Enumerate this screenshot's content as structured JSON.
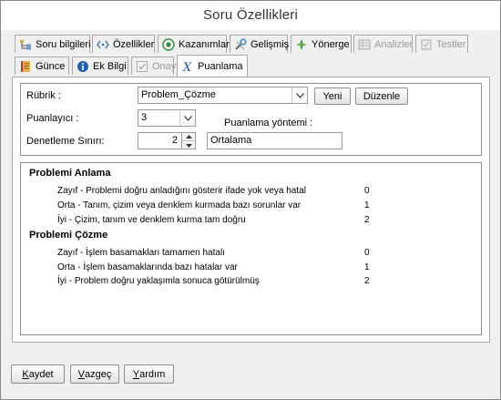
{
  "window": {
    "title": "Soru Özellikleri"
  },
  "tabs": [
    {
      "label": "Soru bilgileri",
      "icon": "info-tree-icon",
      "state": "normal"
    },
    {
      "label": "Özellikler",
      "icon": "code-brackets-icon",
      "state": "normal"
    },
    {
      "label": "Kazanımlar",
      "icon": "target-icon",
      "state": "normal"
    },
    {
      "label": "Gelişmiş",
      "icon": "tools-icon",
      "state": "normal"
    },
    {
      "label": "Yönerge",
      "icon": "compass-icon",
      "state": "normal"
    },
    {
      "label": "Analizler",
      "icon": "table-icon",
      "state": "disabled"
    },
    {
      "label": "Testler",
      "icon": "test-icon",
      "state": "disabled"
    },
    {
      "label": "Günce",
      "icon": "notebook-icon",
      "state": "normal"
    },
    {
      "label": "Ek Bilgi",
      "icon": "info-circle-icon",
      "state": "normal"
    },
    {
      "label": "Onay",
      "icon": "checkbox-icon",
      "state": "disabled"
    },
    {
      "label": "Puanlama",
      "icon": "formula-icon",
      "state": "active"
    }
  ],
  "form": {
    "rubric_label": "Rübrik :",
    "rubric_value": "Problem_Çözme",
    "new_button": "Yeni",
    "edit_button": "Düzenle",
    "scorer_label": "Puanlayıcı :",
    "scorer_value": "3",
    "method_label": "Puanlama yöntemi :",
    "limit_label": "Denetleme Sınırı:",
    "limit_value": "2",
    "method_value": "Ortalama"
  },
  "rubric": [
    {
      "title": "Problemi Anlama",
      "rows": [
        {
          "desc": "Zayıf - Problemi doğru anladığını gösterir ifade yok veya hatal",
          "points": "0"
        },
        {
          "desc": "Orta - Tanım, çizim veya denklem kurmada bazı sorunlar var",
          "points": "1"
        },
        {
          "desc": "İyi - Çizim, tanım ve denklem kurma tam doğru",
          "points": "2"
        }
      ]
    },
    {
      "title": "Problemi Çözme",
      "rows": [
        {
          "desc": "Zayıf - İşlem basamakları tamamen hatalı",
          "points": "0"
        },
        {
          "desc": "Orta - İşlem basamaklarında bazı hatalar var",
          "points": "1"
        },
        {
          "desc": "İyi - Problem doğru yaklaşımla sonuca götürülmüş",
          "points": "2"
        }
      ]
    }
  ],
  "footer": {
    "save": {
      "first": "K",
      "rest": "aydet"
    },
    "cancel": {
      "first": "V",
      "rest": "azgeç"
    },
    "help": {
      "first": "Y",
      "rest": "ardım"
    }
  },
  "colors": {
    "window_bg": "#f0f0f0",
    "panel_bg": "#ffffff",
    "disabled_text": "#9a9a9a",
    "border": "#a9a9a9"
  }
}
